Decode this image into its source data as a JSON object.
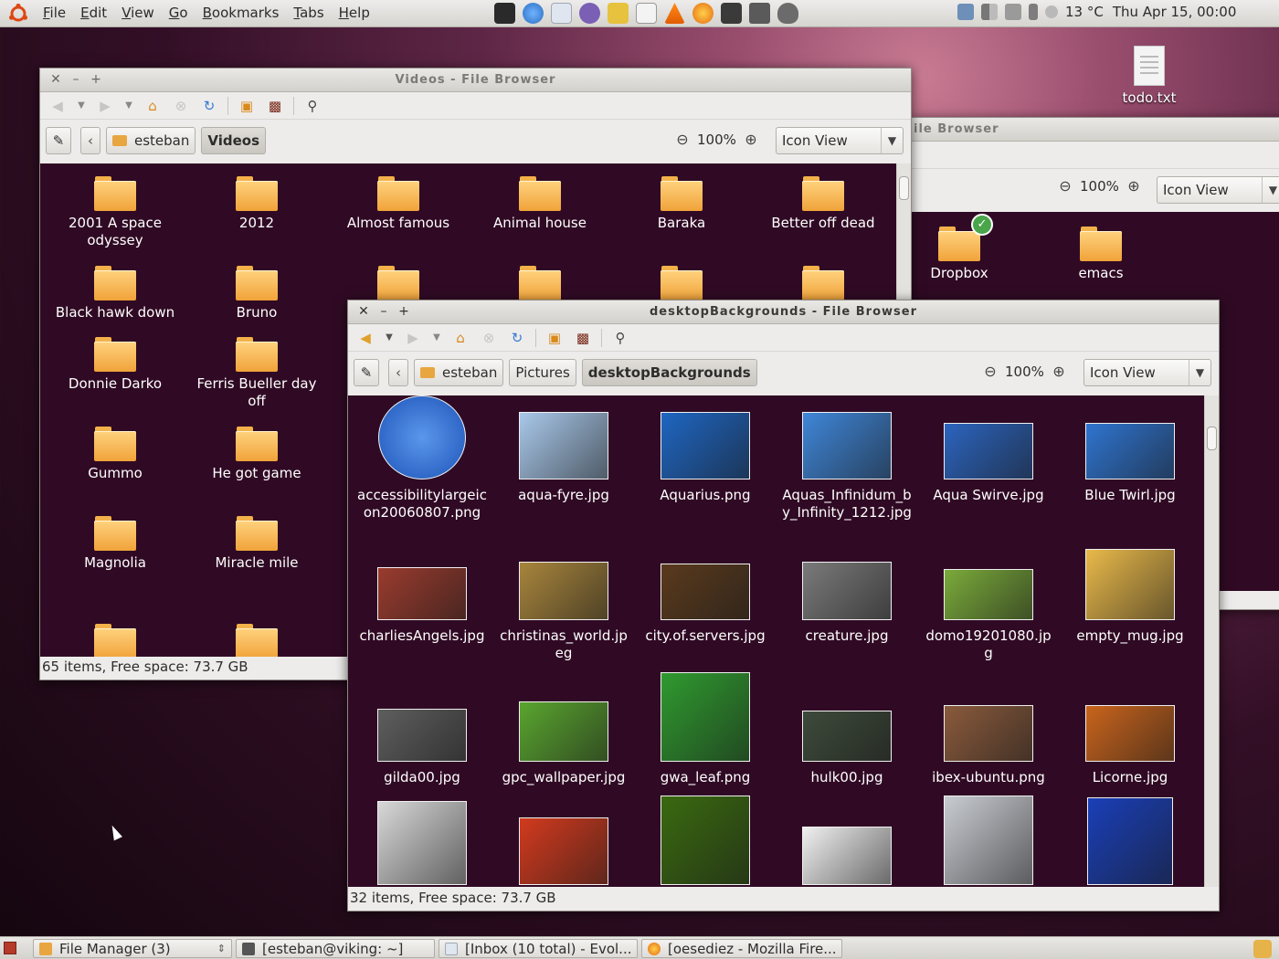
{
  "top_panel": {
    "menus": [
      "File",
      "Edit",
      "View",
      "Go",
      "Bookmarks",
      "Tabs",
      "Help"
    ],
    "launchers": [
      "terminal-icon",
      "globe-icon",
      "mail-icon",
      "chat-icon",
      "lock-icon",
      "text-editor-icon",
      "vlc-icon",
      "firefox-icon",
      "clapper-icon",
      "camera-icon",
      "cat-icon"
    ],
    "weather": "13 °C",
    "clock": "Thu Apr 15, 00:00"
  },
  "desktop": {
    "icons": [
      {
        "label": "todo.txt"
      }
    ]
  },
  "window_back": {
    "title_partial": "ile Browser",
    "zoom": "100%",
    "view_mode": "Icon View",
    "items": [
      {
        "label": "Dropbox"
      },
      {
        "label": "emacs"
      }
    ]
  },
  "window_videos": {
    "title": "Videos - File Browser",
    "path": [
      "esteban",
      "Videos"
    ],
    "zoom": "100%",
    "view_mode": "Icon View",
    "status": "65 items, Free space: 73.7 GB",
    "items": [
      {
        "label": "2001 A space odyssey"
      },
      {
        "label": "2012"
      },
      {
        "label": "Almost famous"
      },
      {
        "label": "Animal house"
      },
      {
        "label": "Baraka"
      },
      {
        "label": "Better off dead"
      },
      {
        "label": "Black hawk down"
      },
      {
        "label": "Bruno"
      },
      {
        "label": ""
      },
      {
        "label": ""
      },
      {
        "label": ""
      },
      {
        "label": ""
      },
      {
        "label": "Donnie Darko"
      },
      {
        "label": "Ferris Bueller day off"
      },
      {
        "label": "Gummo"
      },
      {
        "label": "He got game"
      },
      {
        "label": "Magnolia"
      },
      {
        "label": "Miracle mile"
      },
      {
        "label": ""
      },
      {
        "label": ""
      }
    ]
  },
  "window_backgrounds": {
    "title": "desktopBackgrounds - File Browser",
    "path": [
      "esteban",
      "Pictures",
      "desktopBackgrounds"
    ],
    "zoom": "100%",
    "view_mode": "Icon View",
    "status": "32 items, Free space: 73.7 GB",
    "items": [
      {
        "label": "accessibilitylargeicon20060807.png",
        "color": "#2f6fd3"
      },
      {
        "label": "aqua-fyre.jpg",
        "color": "#a9c8ea"
      },
      {
        "label": "Aquarius.png",
        "color": "#1f66c2"
      },
      {
        "label": "Aquas_Infinidum_by_Infinity_1212.jpg",
        "color": "#3f86d8"
      },
      {
        "label": "Aqua Swirve.jpg",
        "color": "#2c64be"
      },
      {
        "label": "Blue Twirl.jpg",
        "color": "#2f74cf"
      },
      {
        "label": "charliesAngels.jpg",
        "color": "#9a3b2e"
      },
      {
        "label": "christinas_world.jpeg",
        "color": "#a8853c"
      },
      {
        "label": "city.of.servers.jpg",
        "color": "#5a3a1d"
      },
      {
        "label": "creature.jpg",
        "color": "#7a7a7a"
      },
      {
        "label": "domo19201080.jpg",
        "color": "#7aaa3a"
      },
      {
        "label": "empty_mug.jpg",
        "color": "#e9b94a"
      },
      {
        "label": "gilda00.jpg",
        "color": "#5e5e5e"
      },
      {
        "label": "gpc_wallpaper.jpg",
        "color": "#5aa52f"
      },
      {
        "label": "gwa_leaf.png",
        "color": "#2f9a2f"
      },
      {
        "label": "hulk00.jpg",
        "color": "#3d4a3a"
      },
      {
        "label": "ibex-ubuntu.png",
        "color": "#8a5a3c"
      },
      {
        "label": "Licorne.jpg",
        "color": "#c9641c"
      },
      {
        "label": "",
        "color": "#d8d8d8"
      },
      {
        "label": "",
        "color": "#d23a1e"
      },
      {
        "label": "",
        "color": "#3a6a10"
      },
      {
        "label": "",
        "color": "#f0f0f0"
      },
      {
        "label": "",
        "color": "#c9ccd2"
      },
      {
        "label": "",
        "color": "#1a3fb8"
      }
    ]
  },
  "taskbar": {
    "tasks": [
      {
        "label": "File Manager (3)"
      },
      {
        "label": "[esteban@viking: ~]"
      },
      {
        "label": "[Inbox (10 total) - Evol..."
      },
      {
        "label": "[oesediez - Mozilla Fire..."
      }
    ]
  }
}
